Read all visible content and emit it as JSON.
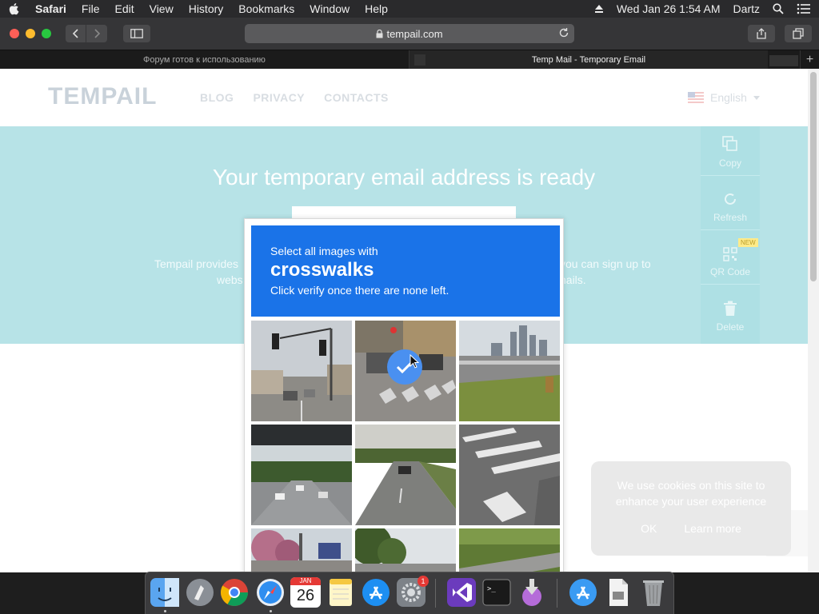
{
  "menubar": {
    "items": [
      "Safari",
      "File",
      "Edit",
      "View",
      "History",
      "Bookmarks",
      "Window",
      "Help"
    ],
    "datetime": "Wed Jan 26  1:54 AM",
    "user": "Dartz"
  },
  "browser": {
    "url": "tempail.com",
    "tabs": [
      {
        "title": "Форум готов к использованию"
      },
      {
        "title": "Temp Mail - Temporary Email"
      }
    ],
    "new_tab": "+"
  },
  "site": {
    "logo": "TEMPAIL",
    "nav": [
      "BLOG",
      "PRIVACY",
      "CONTACTS"
    ],
    "language": "English",
    "hero_title": "Your temporary email address is ready",
    "desc_left": [
      "Tempail provides",
      "webs"
    ],
    "desc_right": [
      "you can sign up to",
      "nails."
    ],
    "actions": [
      {
        "icon": "copy-icon",
        "label": "Copy"
      },
      {
        "icon": "refresh-icon",
        "label": "Refresh"
      },
      {
        "icon": "qr-code-icon",
        "label": "QR Code",
        "badge": "NEW"
      },
      {
        "icon": "trash-icon",
        "label": "Delete"
      }
    ]
  },
  "captcha": {
    "line1": "Select all images with",
    "target": "crosswalks",
    "line3": "Click verify once there are none left.",
    "accent": "#1a73e8",
    "tiles": [
      {
        "scene": "street with traffic lights",
        "selected": false
      },
      {
        "scene": "crosswalk with cars",
        "selected": true
      },
      {
        "scene": "highway with city skyline",
        "selected": false
      },
      {
        "scene": "underpass highway",
        "selected": false
      },
      {
        "scene": "road with car",
        "selected": false
      },
      {
        "scene": "asphalt crosswalk markings",
        "selected": false
      },
      {
        "scene": "street with trees and signs",
        "selected": false
      },
      {
        "scene": "road with trees",
        "selected": false
      },
      {
        "scene": "grass and road",
        "selected": false
      }
    ]
  },
  "cookie": {
    "text_line1": "We use cookies on this site to",
    "text_line2": "enhance your user experience",
    "ok": "OK",
    "learn_more": "Learn more"
  },
  "dock": {
    "apps": [
      "finder",
      "launchpad",
      "chrome",
      "safari",
      "calendar",
      "notes",
      "app-store",
      "system-preferences",
      "visual-studio",
      "terminal",
      "installer",
      "app-store-2",
      "preview",
      "trash"
    ],
    "calendar_month": "JAN",
    "calendar_day": "26",
    "sysprefs_badge": "1"
  }
}
